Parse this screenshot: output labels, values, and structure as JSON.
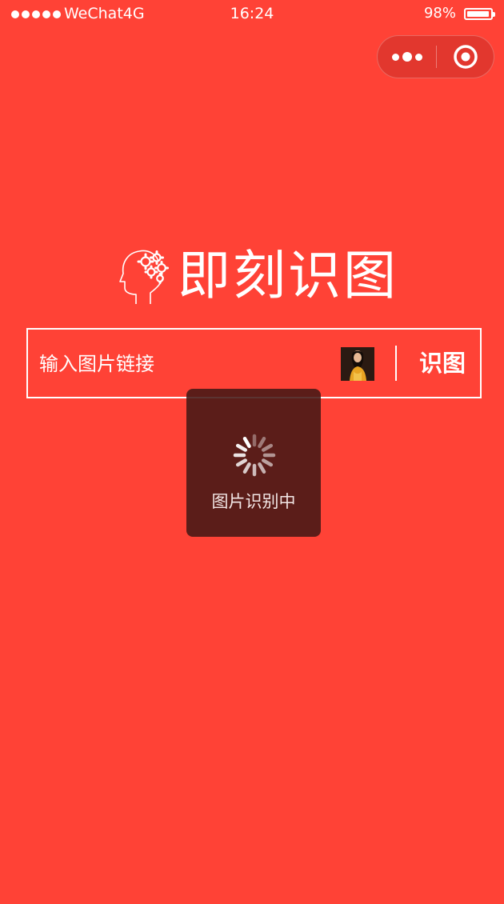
{
  "status_bar": {
    "carrier": "WeChat4G",
    "time": "16:24",
    "battery_percent": "98%",
    "battery_level": 0.98,
    "signal_icon": "signal-dots-icon",
    "battery_icon": "battery-icon"
  },
  "capsule": {
    "more_icon": "more-dots-icon",
    "close_icon": "target-circle-icon"
  },
  "logo": {
    "icon": "head-gears-icon",
    "title": "即刻识图"
  },
  "search": {
    "placeholder": "输入图片链接",
    "value": "",
    "thumbnail_icon": "image-thumbnail",
    "button_label": "识图"
  },
  "toast": {
    "icon": "loading-spinner-icon",
    "message": "图片识别中"
  },
  "colors": {
    "background": "#ff4236",
    "foreground": "#ffffff",
    "toast_background": "#441816"
  }
}
